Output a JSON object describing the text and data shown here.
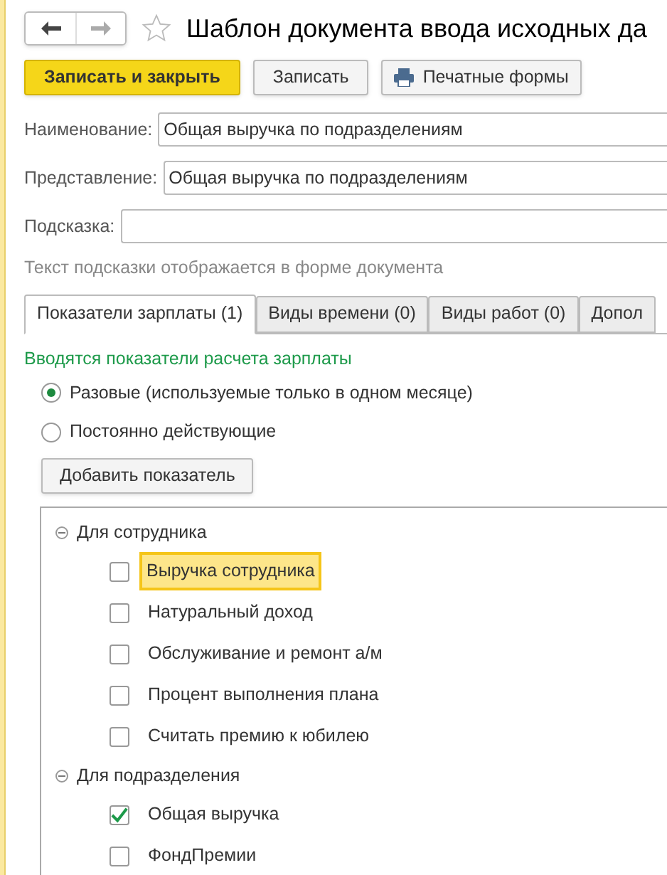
{
  "window": {
    "title": "Шаблон документа ввода исходных да",
    "favorite": false
  },
  "toolbar": {
    "buttons": [
      {
        "label": "Записать и закрыть",
        "kind": "primary"
      },
      {
        "label": "Записать",
        "kind": "plain"
      },
      {
        "label": "Печатные формы",
        "kind": "print"
      }
    ]
  },
  "fields": [
    {
      "label": "Наименование:",
      "value": "Общая выручка по подразделениям"
    },
    {
      "label": "Представление:",
      "value": "Общая выручка по подразделениям"
    },
    {
      "label": "Подсказка:"
    }
  ],
  "hint": "Текст подсказки отображается в форме документа",
  "tabs": [
    {
      "label": "Показатели зарплаты (1)",
      "selected": true
    },
    {
      "label": "Виды времени (0)",
      "selected": false
    },
    {
      "label": "Виды работ (0)",
      "selected": false
    },
    {
      "label": "Допол",
      "selected": false
    }
  ],
  "section_title": "Вводятся показатели расчета зарплаты",
  "radios": [
    {
      "label": "Разовые (используемые только в одном месяце)",
      "selected": true
    },
    {
      "label": "Постоянно действующие",
      "selected": false
    }
  ],
  "add_button": "Добавить показатель",
  "tree": [
    {
      "label": "Для сотрудника",
      "expanded": true,
      "children": [
        {
          "label": "Выручка сотрудника",
          "checked": false,
          "selected": true
        },
        {
          "label": "Натуральный доход",
          "checked": false,
          "selected": false
        },
        {
          "label": "Обслуживание и ремонт а/м",
          "checked": false,
          "selected": false
        },
        {
          "label": "Процент выполнения плана",
          "checked": false,
          "selected": false
        },
        {
          "label": "Считать премию к юбилею",
          "checked": false,
          "selected": false
        }
      ]
    },
    {
      "label": "Для подразделения",
      "expanded": true,
      "children": [
        {
          "label": "Общая выручка",
          "checked": true,
          "selected": false
        },
        {
          "label": "ФондПремии",
          "checked": false,
          "selected": false
        }
      ]
    }
  ]
}
